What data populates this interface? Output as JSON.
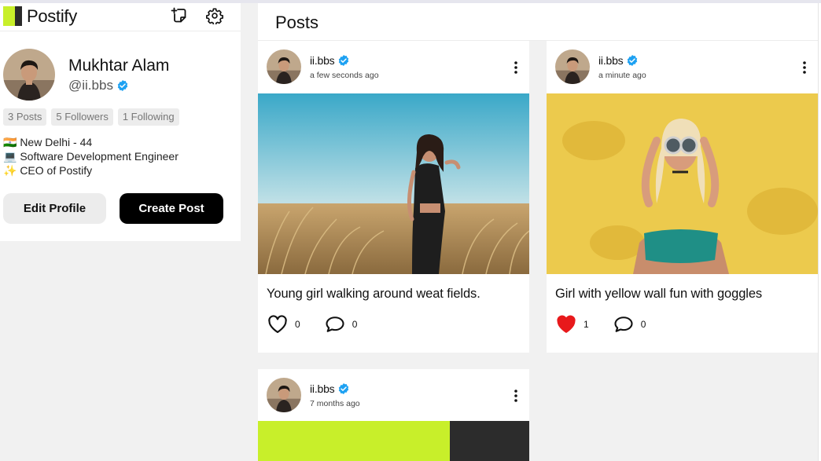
{
  "app": {
    "name": "Postify"
  },
  "icons": {
    "new_post": "new-post-icon",
    "settings": "gear-icon",
    "verified": "verified-badge-icon",
    "more": "more-vertical-icon",
    "like": "heart-icon",
    "comment": "comment-icon"
  },
  "colors": {
    "brand_lime": "#c8ef2a",
    "brand_dark": "#2b2b2b",
    "verified_blue": "#1da1f2",
    "like_red": "#e8191b"
  },
  "profile": {
    "name": "Mukhtar Alam",
    "handle": "@ii.bbs",
    "verified": true,
    "stats": {
      "posts": "3 Posts",
      "followers": "5 Followers",
      "following": "1 Following"
    },
    "bio": [
      "🇮🇳 New Delhi - 44",
      "💻 Software Development Engineer",
      "✨ CEO of Postify"
    ],
    "edit_label": "Edit Profile",
    "create_label": "Create Post"
  },
  "feed": {
    "title": "Posts",
    "posts": [
      {
        "username": "ii.bbs",
        "time": "a few seconds ago",
        "caption": "Young girl walking around weat fields.",
        "likes": "0",
        "comments": "0",
        "liked": false
      },
      {
        "username": "ii.bbs",
        "time": "a minute ago",
        "caption": "Girl with yellow wall fun with goggles",
        "likes": "1",
        "comments": "0",
        "liked": true
      },
      {
        "username": "ii.bbs",
        "time": "7 months ago",
        "caption": "",
        "likes": "",
        "comments": "",
        "liked": false
      }
    ]
  }
}
